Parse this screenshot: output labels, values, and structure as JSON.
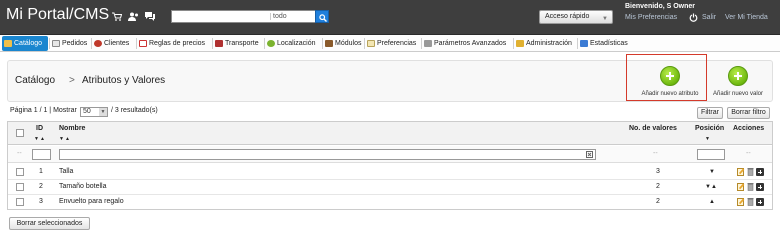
{
  "header": {
    "brand": "Mi Portal/CMS",
    "quick_icons": [
      "shopping-cart-icon",
      "users-icon",
      "chat-icon"
    ],
    "search": {
      "value": "",
      "placeholder": "",
      "scope": "todo"
    },
    "quick_access": "Acceso rápido",
    "welcome": "Bienvenido, S Owner",
    "links": {
      "preferences": "Mis Preferencias",
      "logout": "Salir",
      "view_store": "Ver Mi Tienda"
    }
  },
  "nav": {
    "items": [
      {
        "label": "Catálogo",
        "icon": "catalog-icon",
        "active": true
      },
      {
        "label": "Pedidos",
        "icon": "orders-icon"
      },
      {
        "label": "Clientes",
        "icon": "customers-icon"
      },
      {
        "label": "Reglas de precios",
        "icon": "price-rules-icon"
      },
      {
        "label": "Transporte",
        "icon": "shipping-icon"
      },
      {
        "label": "Localización",
        "icon": "localization-icon"
      },
      {
        "label": "Módulos",
        "icon": "modules-icon"
      },
      {
        "label": "Preferencias",
        "icon": "preferences-icon"
      },
      {
        "label": "Parámetros Avanzados",
        "icon": "advanced-params-icon"
      },
      {
        "label": "Administración",
        "icon": "administration-icon"
      },
      {
        "label": "Estadísticas",
        "icon": "stats-icon"
      }
    ]
  },
  "toolbar": {
    "breadcrumb": "Catálogo",
    "breadcrumb_separator": ">",
    "title": "Atributos y Valores",
    "add_attribute": "Añadir nuevo atributo",
    "add_value": "Añadir nuevo valor"
  },
  "pagination": {
    "page_text": "Página 1 / 1 | Mostrar",
    "per_page": "50",
    "results": "/ 3 resultado(s)",
    "filter_button": "Filtrar",
    "reset_button": "Borrar filtro"
  },
  "table": {
    "columns": {
      "id": "ID",
      "name": "Nombre",
      "values": "No. de valores",
      "position": "Posición",
      "actions": "Acciones"
    },
    "filter_placeholder_dash": "--",
    "rows": [
      {
        "id": "1",
        "name": "Talla",
        "values": "3",
        "position_arrows": "▼"
      },
      {
        "id": "2",
        "name": "Tamaño botella",
        "values": "2",
        "position_arrows": "▼▲"
      },
      {
        "id": "3",
        "name": "Envuelto para regalo",
        "values": "2",
        "position_arrows": "▲"
      }
    ]
  },
  "bulk": {
    "delete_selected": "Borrar seleccionados"
  }
}
